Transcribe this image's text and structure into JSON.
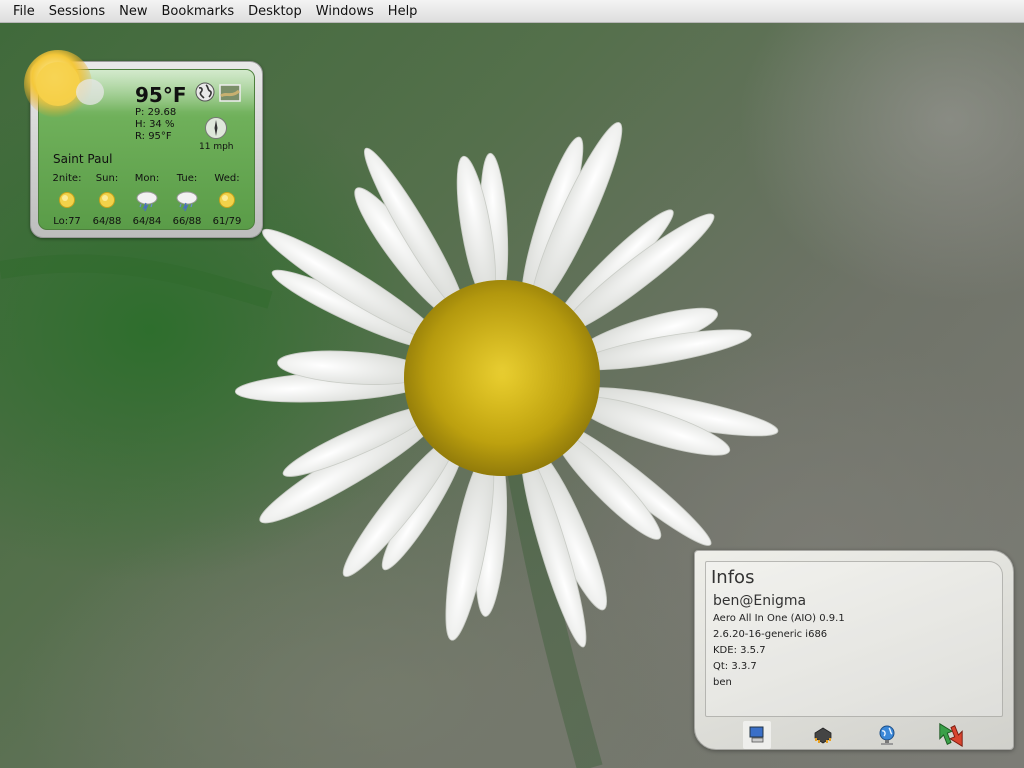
{
  "menubar": {
    "items": [
      "File",
      "Sessions",
      "New",
      "Bookmarks",
      "Desktop",
      "Windows",
      "Help"
    ]
  },
  "weather": {
    "temperature": "95°F",
    "pressure": "P: 29.68",
    "humidity": "H: 34 %",
    "real_feel": "R: 95°F",
    "wind": "11 mph",
    "city": "Saint Paul",
    "forecast": [
      {
        "day": "2nite:",
        "icon": "sun-icon",
        "range": "Lo:77"
      },
      {
        "day": "Sun:",
        "icon": "sun-icon",
        "range": "64/88"
      },
      {
        "day": "Mon:",
        "icon": "thunderstorm-icon",
        "range": "64/84"
      },
      {
        "day": "Tue:",
        "icon": "thunderstorm-icon",
        "range": "66/88"
      },
      {
        "day": "Wed:",
        "icon": "sun-icon",
        "range": "61/79"
      }
    ]
  },
  "infos": {
    "title": "Infos",
    "user": "ben@Enigma",
    "lines": [
      "Aero All In One (AIO) 0.9.1",
      "2.6.20-16-generic i686",
      "KDE: 3.5.7",
      "Qt: 3.3.7",
      "ben"
    ],
    "buttons": [
      "computer-icon",
      "chip-icon",
      "network-globe-icon",
      "transfer-arrows-icon"
    ]
  },
  "colors": {
    "widget_green": "#6fb05a",
    "daisy_yellow": "#e0c21a",
    "petal_white": "#f4f4f0"
  }
}
